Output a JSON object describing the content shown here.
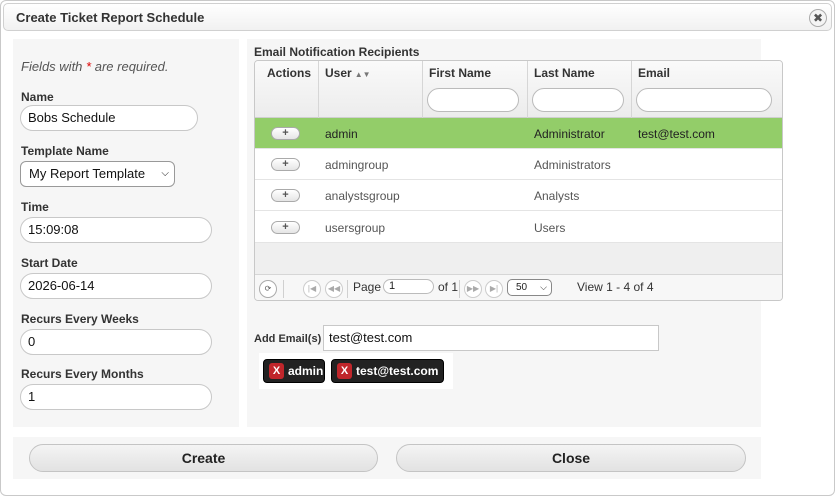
{
  "dialog": {
    "title": "Create Ticket Report Schedule",
    "close_icon": "close-icon"
  },
  "form": {
    "required_note_prefix": "Fields with",
    "required_star": "*",
    "required_note_suffix": "are required.",
    "name_label": "Name",
    "name_value": "Bobs Schedule",
    "template_label": "Template Name",
    "template_value": "My Report Template",
    "time_label": "Time",
    "time_value": "15:09:08",
    "start_date_label": "Start Date",
    "start_date_value": "2026-06-14",
    "weeks_label": "Recurs Every Weeks",
    "weeks_value": "0",
    "months_label": "Recurs Every Months",
    "months_value": "1"
  },
  "recipients": {
    "caption": "Email Notification Recipients",
    "columns": [
      "Actions",
      "User",
      "First Name",
      "Last Name",
      "Email"
    ],
    "sort_column": "User",
    "rows": [
      {
        "user": "admin",
        "first_name": "",
        "last_name": "Administrator",
        "email": "test@test.com",
        "selected": true
      },
      {
        "user": "admingroup",
        "first_name": "",
        "last_name": "Administrators",
        "email": "",
        "selected": false
      },
      {
        "user": "analystsgroup",
        "first_name": "",
        "last_name": "Analysts",
        "email": "",
        "selected": false
      },
      {
        "user": "usersgroup",
        "first_name": "",
        "last_name": "Users",
        "email": "",
        "selected": false
      }
    ],
    "add_button_label": "+",
    "pager": {
      "page_label": "Page",
      "page_value": "1",
      "of_label": "of 1",
      "page_size": "50",
      "view_text": "View 1 - 4 of 4"
    }
  },
  "emails": {
    "label": "Add Email(s)",
    "input_value": "test@test.com",
    "chips": [
      {
        "remove_label": "X",
        "label": "admin"
      },
      {
        "remove_label": "X",
        "label": "test@test.com"
      }
    ]
  },
  "footer": {
    "create_label": "Create",
    "close_label": "Close"
  },
  "colors": {
    "selected_row": "#93cd69",
    "chip_bg": "#222222",
    "chip_remove": "#c0262b",
    "required_star": "#dd0000"
  }
}
